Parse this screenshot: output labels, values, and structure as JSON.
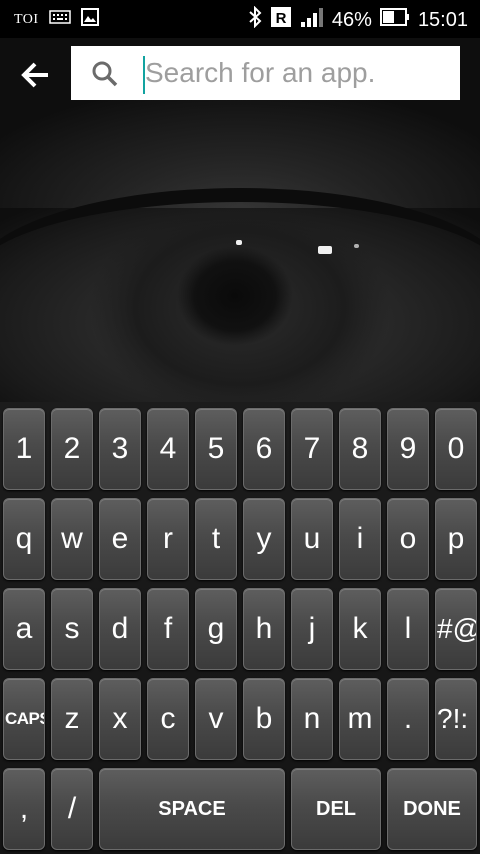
{
  "status_bar": {
    "carrier_label": "TOI",
    "battery_percent": "46%",
    "time": "15:01",
    "roaming_label": "R",
    "icons": [
      "keyboard-icon",
      "image-icon",
      "bluetooth-icon",
      "roaming-icon",
      "signal-icon",
      "battery-icon"
    ]
  },
  "search": {
    "placeholder": "Search for an app.",
    "value": ""
  },
  "keyboard": {
    "row1": [
      "1",
      "2",
      "3",
      "4",
      "5",
      "6",
      "7",
      "8",
      "9",
      "0"
    ],
    "row2": [
      "q",
      "w",
      "e",
      "r",
      "t",
      "y",
      "u",
      "i",
      "o",
      "p"
    ],
    "row3": [
      "a",
      "s",
      "d",
      "f",
      "g",
      "h",
      "j",
      "k",
      "l",
      "#@"
    ],
    "row4": [
      "CAPS",
      "z",
      "x",
      "c",
      "v",
      "b",
      "n",
      "m",
      ".",
      "?!:"
    ],
    "row5": [
      ",",
      "/",
      "SPACE",
      "DEL",
      "DONE"
    ]
  },
  "colors": {
    "accent_caret": "#12a3a0",
    "search_background": "#ffffff",
    "status_bar_background": "#000000"
  }
}
